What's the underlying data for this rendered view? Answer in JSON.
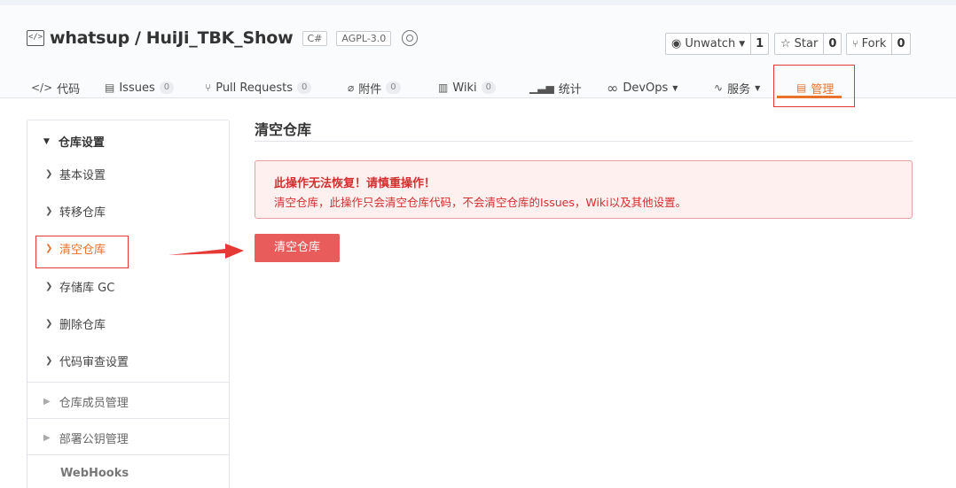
{
  "repo": {
    "owner": "whatsup",
    "separator": "/",
    "name": "HuiJi_TBK_Show",
    "language_tag": "C#",
    "license_tag": "AGPL-3.0"
  },
  "actions": {
    "watch": {
      "label": "Unwatch",
      "count": "1"
    },
    "star": {
      "label": "Star",
      "count": "0"
    },
    "fork": {
      "label": "Fork",
      "count": "0"
    }
  },
  "nav": {
    "code": "代码",
    "issues": {
      "label": "Issues",
      "count": "0"
    },
    "pulls": {
      "label": "Pull Requests",
      "count": "0"
    },
    "attachments": {
      "label": "附件",
      "count": "0"
    },
    "wiki": {
      "label": "Wiki",
      "count": "0"
    },
    "stats": "统计",
    "devops": "DevOps",
    "services": "服务",
    "manage": "管理"
  },
  "sidebar": {
    "section_title": "仓库设置",
    "items": [
      {
        "label": "基本设置"
      },
      {
        "label": "转移仓库"
      },
      {
        "label": "清空仓库"
      },
      {
        "label": "存储库 GC"
      },
      {
        "label": "删除仓库"
      },
      {
        "label": "代码审查设置"
      }
    ],
    "members": "仓库成员管理",
    "deploy_keys": "部署公钥管理",
    "webhooks": "WebHooks"
  },
  "main": {
    "title": "清空仓库",
    "alert_title": "此操作无法恢复！请慎重操作！",
    "alert_text": "清空仓库，此操作只会清空仓库代码，不会清空仓库的Issues，Wiki以及其他设置。",
    "button": "清空仓库"
  },
  "colors": {
    "accent": "#e8722c",
    "danger": "#e85c5c",
    "annotation": "#e53935"
  }
}
